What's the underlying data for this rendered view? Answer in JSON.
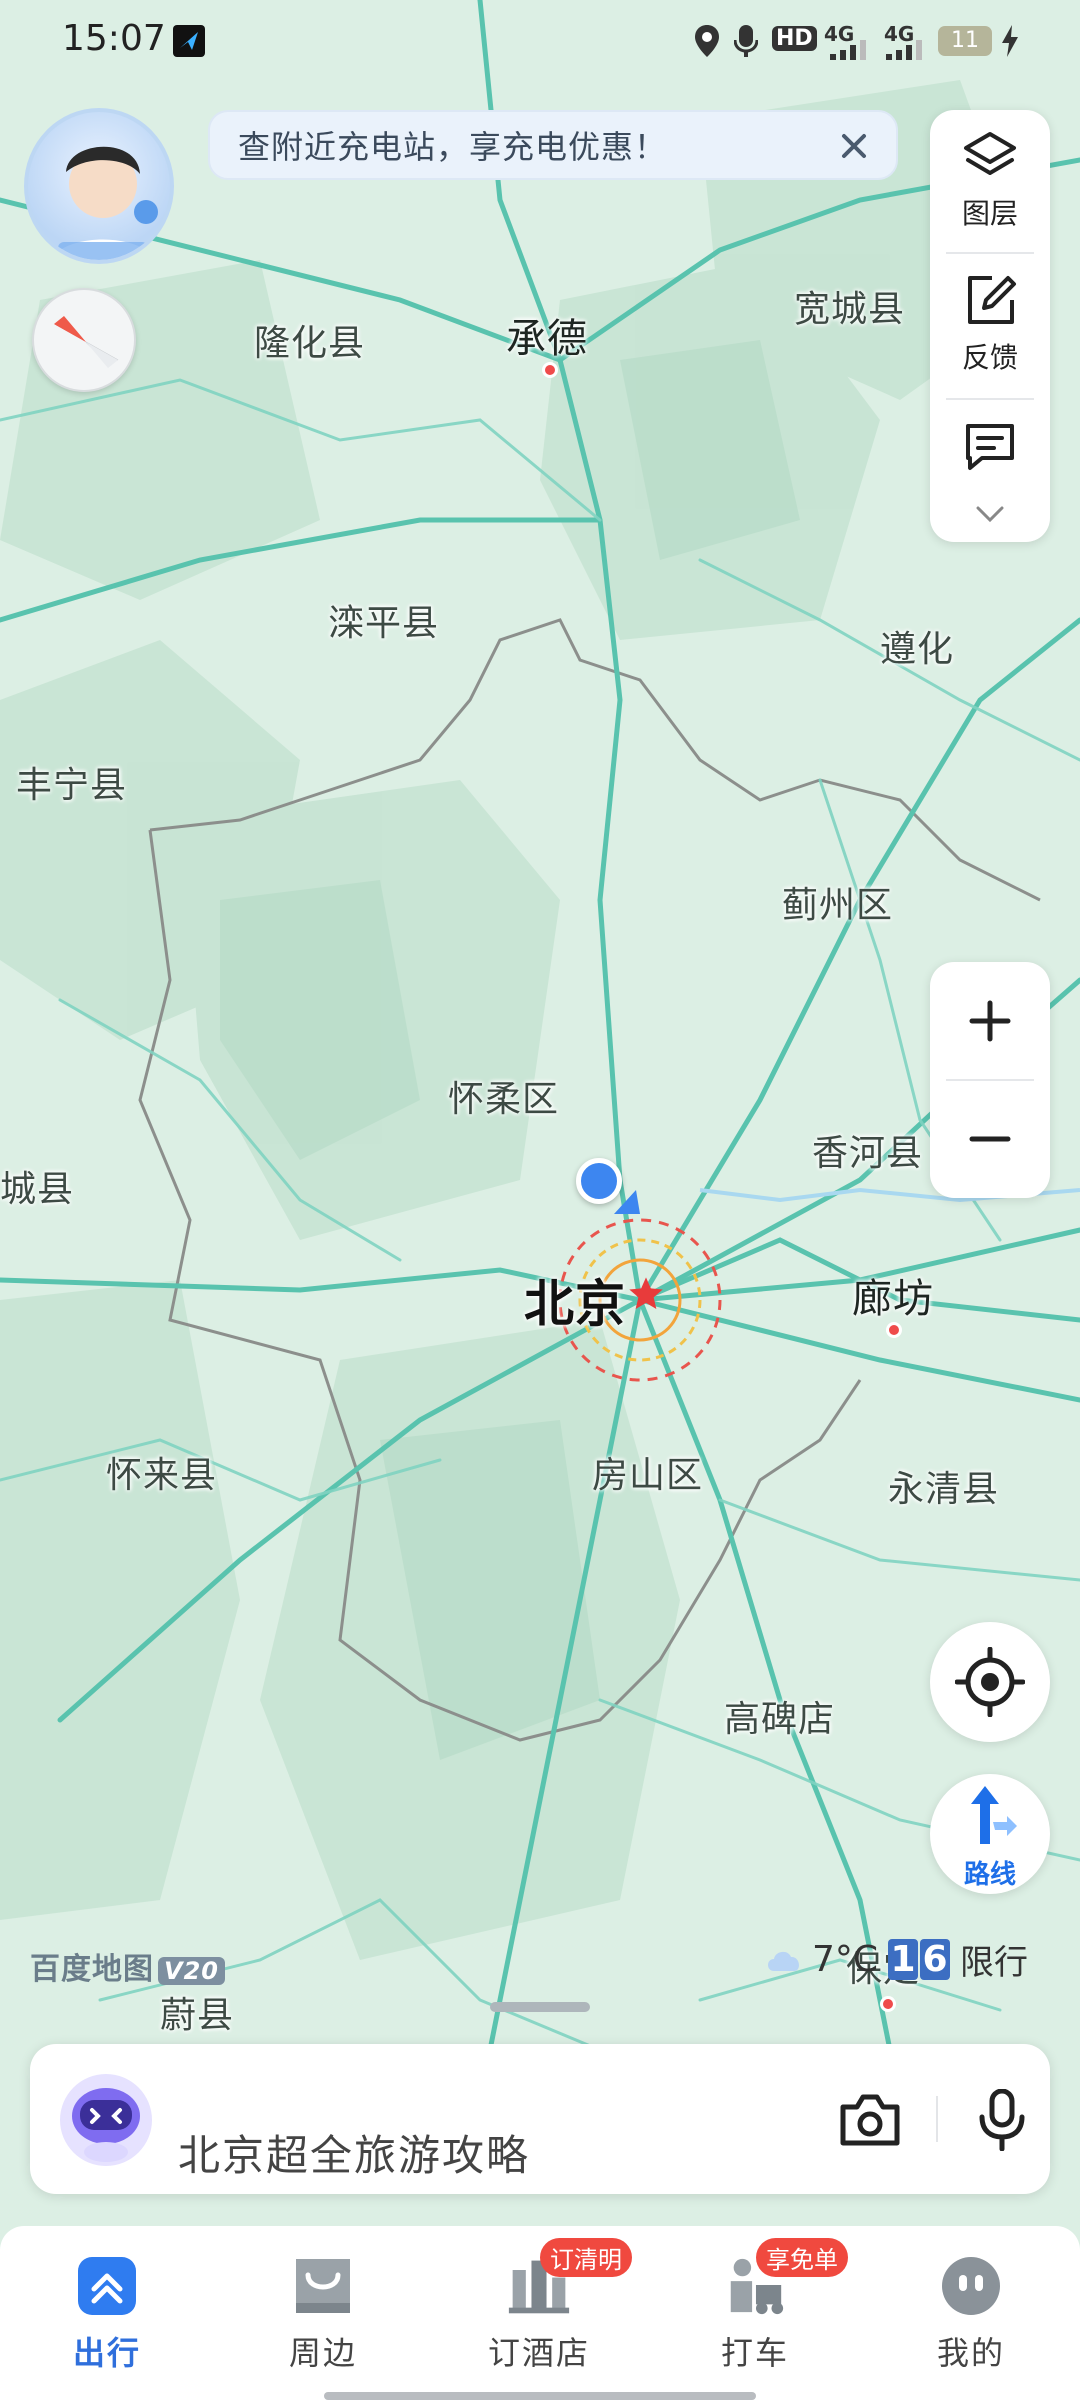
{
  "status_bar": {
    "time": "15:07",
    "icons": [
      "app-notification-icon",
      "location-icon",
      "mic-icon",
      "hd-icon",
      "signal-4g-icon",
      "signal-4g-icon",
      "battery-icon",
      "charging-icon"
    ],
    "hd_label": "HD",
    "network_1": "4G",
    "network_2": "4G",
    "battery_level": "11"
  },
  "promo_banner": {
    "text": "查附近充电站，享充电优惠！"
  },
  "tools": {
    "layers_label": "图层",
    "feedback_label": "反馈"
  },
  "map": {
    "labels": {
      "longhua": "隆化县",
      "chengde": "承德",
      "kuancheng": "宽城县",
      "luanping": "滦平县",
      "zunhua": "遵化",
      "fengning": "丰宁县",
      "jizhou": "蓟州区",
      "huairou": "怀柔区",
      "xianghe": "香河县",
      "chicheng": "城县",
      "beijing": "北京",
      "langfang": "廊坊",
      "huailai": "怀来县",
      "fangshan": "房山区",
      "yongqing": "永清县",
      "gaobeidian": "高碑店",
      "yuxian": "蔚县",
      "baoding": "保定"
    },
    "brand": "百度地图",
    "brand_version": "V20",
    "weather_icon": "cloud-icon",
    "temperature": "7°C",
    "plate_limit_digits": [
      "1",
      "6"
    ],
    "plate_limit_label": "限行"
  },
  "search": {
    "text": "北京超全旅游攻略"
  },
  "bottom_nav": {
    "items": [
      {
        "label": "出行",
        "icon": "travel-icon"
      },
      {
        "label": "周边",
        "icon": "nearby-icon"
      },
      {
        "label": "订酒店",
        "icon": "hotel-icon",
        "badge": "订清明"
      },
      {
        "label": "打车",
        "icon": "taxi-icon",
        "badge": "享免单"
      },
      {
        "label": "我的",
        "icon": "profile-icon"
      }
    ]
  },
  "colors": {
    "map_bg": "#dff0e6",
    "road": "#5ac8b4",
    "accent_blue": "#2f6fdc",
    "badge_red": "#f0493f"
  }
}
